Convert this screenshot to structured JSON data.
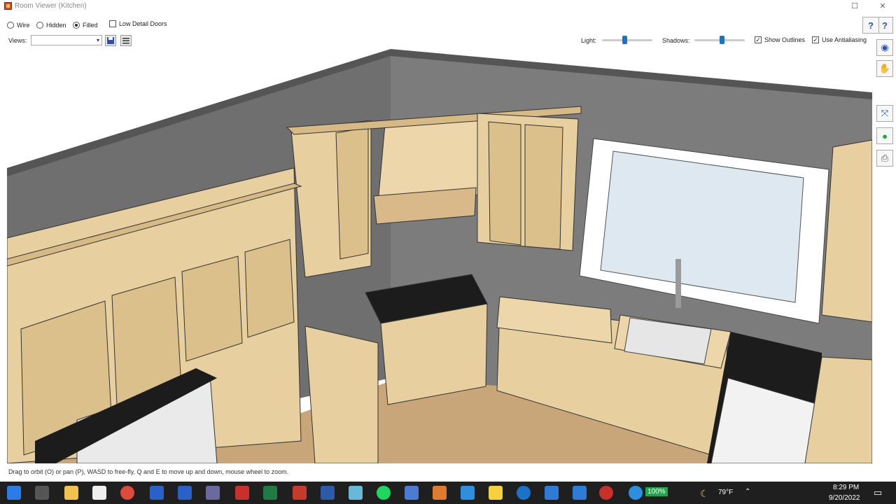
{
  "window": {
    "title": "Room Viewer (Kitchen)"
  },
  "render_modes": [
    {
      "label": "Wire",
      "selected": false
    },
    {
      "label": "Hidden",
      "selected": false
    },
    {
      "label": "Filled",
      "selected": true
    }
  ],
  "low_detail_doors": {
    "label": "Low Detail Doors",
    "checked": false
  },
  "views": {
    "label": "Views:",
    "value": ""
  },
  "light": {
    "label": "Light:",
    "value": 0.45
  },
  "shadows": {
    "label": "Shadows:",
    "value": 0.55
  },
  "show_outlines": {
    "label": "Show Outlines",
    "checked": true
  },
  "use_antialiasing": {
    "label": "Use Antialiasing",
    "checked": true
  },
  "status": {
    "text": "Drag to orbit (O) or pan (P), WASD to free-fly, Q and E to move up and down, mouse wheel to zoom."
  },
  "taskbar": {
    "battery": "100%",
    "weather": "79°F",
    "time": "8:29 PM",
    "date": "9/20/2022"
  },
  "colors": {
    "wall": "#7c7c7c",
    "wood": "#e8cf9f",
    "floor": "#c8a67a",
    "counter": "#1c1c1c",
    "accent": "#1a73c9"
  }
}
